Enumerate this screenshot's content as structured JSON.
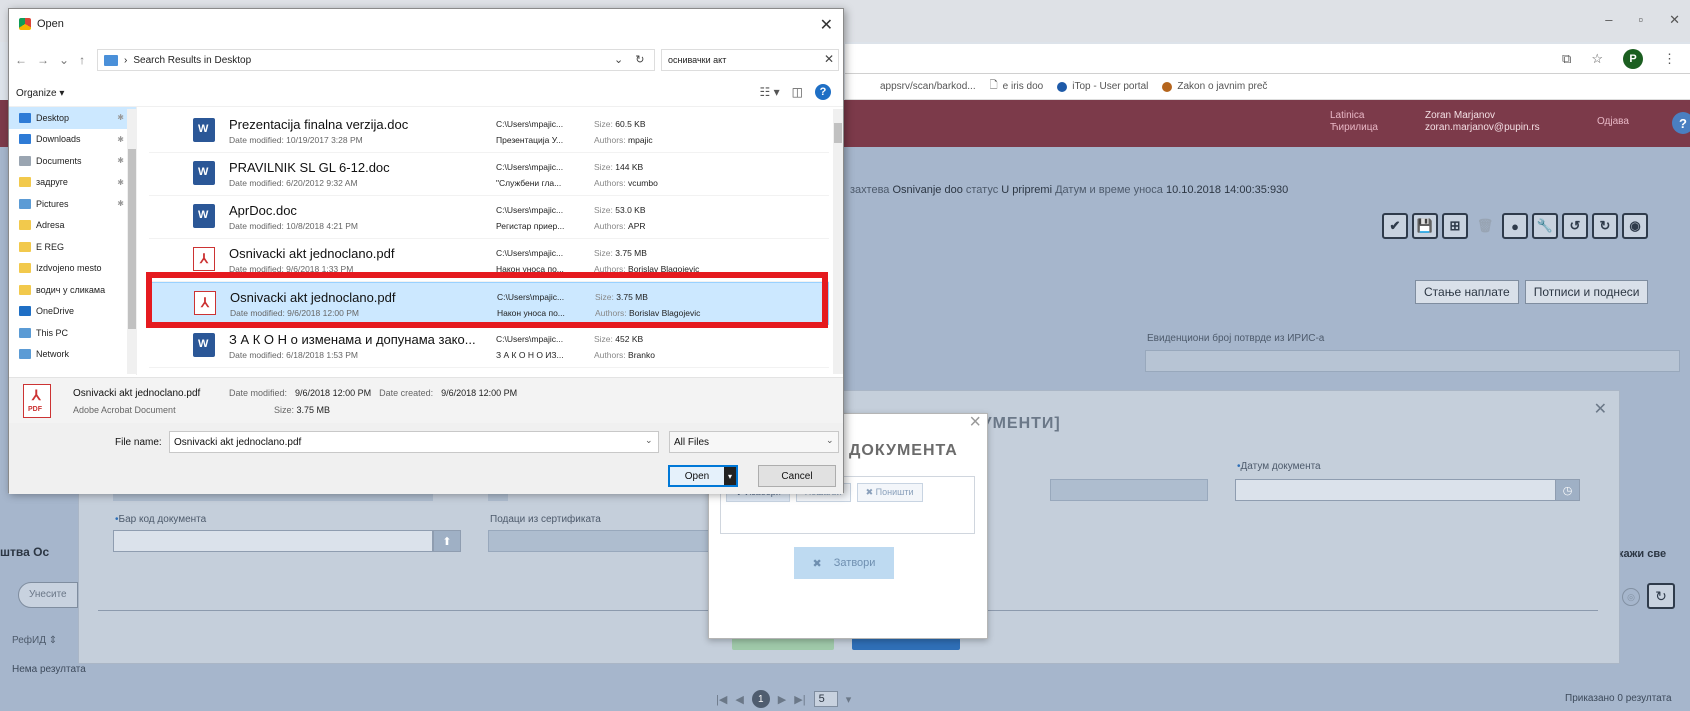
{
  "browser": {
    "window_controls": [
      "–",
      "▫",
      "✕"
    ],
    "bookmarks": [
      {
        "label": "appsrv/scan/barkod...",
        "color": "#ffffff"
      },
      {
        "label": "e iris doo",
        "color": "#ffffff"
      },
      {
        "label": "iTop - User portal",
        "color": "#1e5aa8"
      },
      {
        "label": "Zakon o javnim preč",
        "color": "#b5651d"
      }
    ],
    "profile_initial": "P"
  },
  "app": {
    "header": {
      "lang_line1": "Latinica",
      "lang_line2": "Ћирилица",
      "user_name": "Zoran Marjanov",
      "user_email": "zoran.marjanov@pupin.rs",
      "logout": "Одјава",
      "help": "?"
    },
    "status": {
      "label1": "захтева",
      "value1": "Osnivanje doo",
      "label2": "статус",
      "value2": "U pripremi",
      "label3": "Датум и време уноса",
      "value3": "10.10.2018 14:00:35:930"
    },
    "toolbar_icons": [
      "✔",
      "💾",
      "⊞",
      "🗑",
      "●",
      "🔧",
      "↺",
      "↻",
      "◉"
    ],
    "tabs_right": [
      "Стање наплате",
      "Потписи и поднеси"
    ],
    "iris_label": "Евиденциони број потврде из ИРИС-а",
    "left_label": "штва  Ос",
    "left_input_placeholder": "Унесите",
    "left_ref": "РефИД ⇕",
    "left_none": "Нема резултата",
    "show_all": "кажи све",
    "pager": {
      "current": "1",
      "page_size": "5"
    },
    "shown": "Приказано 0 резултата",
    "doc_modal": {
      "title": "ОКУМЕНТИ]",
      "date_label": "Датум документа",
      "barcode_label": "Бар код документа",
      "cert_label": "Подаци из сертификата"
    },
    "upload_dialog": {
      "title": "ДОКУМЕНТА",
      "btn_choose": "✚ Изабери",
      "btn_upload": "Пошаљи",
      "btn_cancel": "✖ Поништи",
      "btn_close": "Затвори"
    }
  },
  "open_dialog": {
    "title": "Open",
    "breadcrumb": "Search Results in Desktop",
    "search_value": "оснивачки акт",
    "organize": "Organize ▾",
    "nav_items": [
      {
        "label": "Desktop",
        "color": "#2e7bd6",
        "pin": true,
        "selected": true
      },
      {
        "label": "Downloads",
        "color": "#2e7bd6",
        "pin": true,
        "selected": false
      },
      {
        "label": "Documents",
        "color": "#9aa5b1",
        "pin": true,
        "selected": false
      },
      {
        "label": "задруге",
        "color": "#f2c94c",
        "pin": true,
        "selected": false
      },
      {
        "label": "Pictures",
        "color": "#5b9bd5",
        "pin": true,
        "selected": false
      },
      {
        "label": "Adresa",
        "color": "#f2c94c",
        "pin": false,
        "selected": false
      },
      {
        "label": "E REG",
        "color": "#f2c94c",
        "pin": false,
        "selected": false
      },
      {
        "label": "Izdvojeno mesto",
        "color": "#f2c94c",
        "pin": false,
        "selected": false
      },
      {
        "label": "водич у сликама",
        "color": "#f2c94c",
        "pin": false,
        "selected": false
      },
      {
        "label": "OneDrive",
        "color": "#1f6fc5",
        "pin": false,
        "selected": false
      },
      {
        "label": "This PC",
        "color": "#5b9bd5",
        "pin": false,
        "selected": false
      },
      {
        "label": "Network",
        "color": "#5b9bd5",
        "pin": false,
        "selected": false
      }
    ],
    "files": [
      {
        "name": "Prezentacija finalna verzija.doc",
        "type": "doc",
        "date": "Date modified: 10/19/2017 3:28 PM",
        "path": "C:\\Users\\mpajic...",
        "desc": "Презентација У...",
        "size": "60.5 KB",
        "author": "mpajic"
      },
      {
        "name": "PRAVILNIK SL GL 6-12.doc",
        "type": "doc",
        "date": "Date modified: 6/20/2012 9:32 AM",
        "path": "C:\\Users\\mpajic...",
        "desc": "\"Службени гла...",
        "size": "144 KB",
        "author": "vcumbo"
      },
      {
        "name": "AprDoc.doc",
        "type": "doc",
        "date": "Date modified: 10/8/2018 4:21 PM",
        "path": "C:\\Users\\mpajic...",
        "desc": "Регистар приер...",
        "size": "53.0 KB",
        "author": "APR"
      },
      {
        "name": "Osnivacki akt jednoclano.pdf",
        "type": "pdf",
        "date": "Date modified: 9/6/2018 1:33 PM",
        "path": "C:\\Users\\mpajic...",
        "desc": "Након уноса по...",
        "size": "3.75 MB",
        "author": "Borislav Blagojevic"
      },
      {
        "name": "Osnivacki akt jednoclano.pdf",
        "type": "pdf",
        "date": "Date modified: 9/6/2018 12:00 PM",
        "path": "C:\\Users\\mpajic...",
        "desc": "Након уноса по...",
        "size": "3.75 MB",
        "author": "Borislav Blagojevic",
        "selected": true
      },
      {
        "name": "З А К О Н о изменама и допунама зако...",
        "type": "doc",
        "date": "Date modified: 6/18/2018 1:53 PM",
        "path": "C:\\Users\\mpajic...",
        "desc": "З А К О Н О ИЗ...",
        "size": "452 KB",
        "author": "Branko"
      }
    ],
    "size_key": "Size:",
    "author_key": "Authors:",
    "details": {
      "name": "Osnivacki akt jednoclano.pdf",
      "type": "Adobe Acrobat Document",
      "modified_key": "Date modified:",
      "modified_val": "9/6/2018 12:00 PM",
      "created_key": "Date created:",
      "created_val": "9/6/2018 12:00 PM",
      "size_key": "Size:",
      "size_val": "3.75 MB"
    },
    "file_name_label": "File name:",
    "file_name_value": "Osnivacki akt jednoclano.pdf",
    "file_type": "All Files",
    "open_label": "Open",
    "cancel_label": "Cancel",
    "highlight_color": "#e51a1f"
  }
}
